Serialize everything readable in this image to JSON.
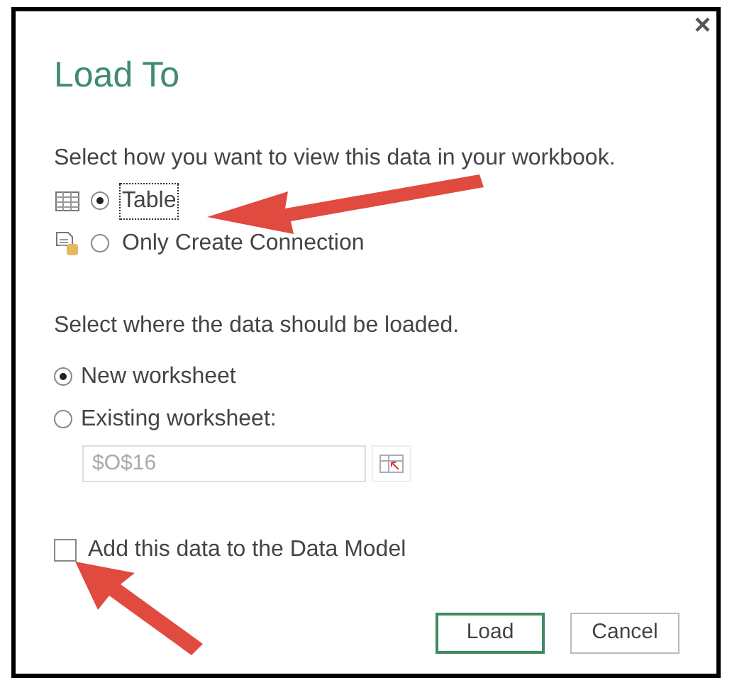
{
  "dialog": {
    "title": "Load To",
    "close": "×"
  },
  "view_prompt": "Select how you want to view this data in your workbook.",
  "view_options": [
    {
      "kind": "table",
      "label": "Table",
      "selected": true
    },
    {
      "kind": "connection",
      "label": "Only Create Connection",
      "selected": false
    }
  ],
  "location_prompt": "Select where the data should be loaded.",
  "location_options": [
    {
      "label": "New worksheet",
      "selected": true
    },
    {
      "label": "Existing worksheet:",
      "selected": false
    }
  ],
  "cell_field": {
    "value": "$O$16",
    "disabled": true
  },
  "data_model": {
    "label": "Add this data to the Data Model",
    "checked": false
  },
  "buttons": [
    {
      "label": "Load",
      "default": true
    },
    {
      "label": "Cancel",
      "default": false
    }
  ]
}
